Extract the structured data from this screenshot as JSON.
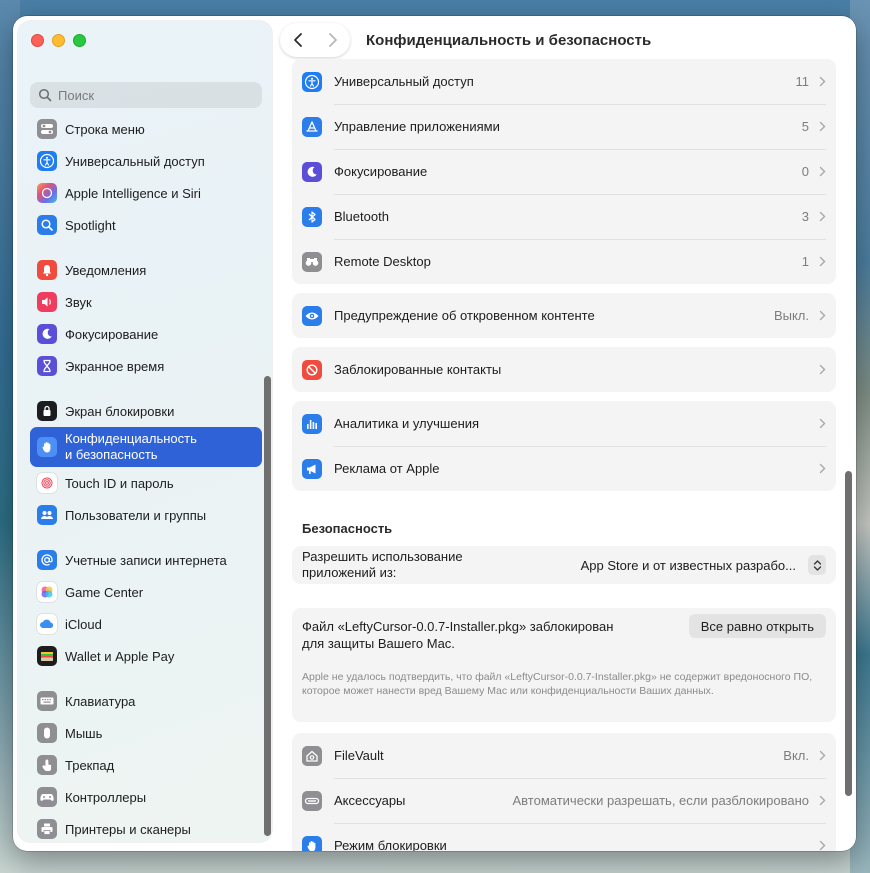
{
  "window": {
    "title": "Конфиденциальность и безопасность"
  },
  "search": {
    "placeholder": "Поиск"
  },
  "sidebar": {
    "items": [
      {
        "label": "Строка меню",
        "icon": "menubar-icon",
        "color": "#8e8e93"
      },
      {
        "label": "Универсальный доступ",
        "icon": "accessibility-icon",
        "color": "#1f7cf1"
      },
      {
        "label": "Apple Intelligence и Siri",
        "icon": "siri-icon",
        "color": "#e58a5a"
      },
      {
        "label": "Spotlight",
        "icon": "spotlight-icon",
        "color": "#2b7de9"
      },
      {
        "label": "Уведомления",
        "icon": "notifications-icon",
        "color": "#ef4b3f"
      },
      {
        "label": "Звук",
        "icon": "sound-icon",
        "color": "#ee3d5f"
      },
      {
        "label": "Фокусирование",
        "icon": "focus-icon",
        "color": "#5b4fd8"
      },
      {
        "label": "Экранное время",
        "icon": "screentime-icon",
        "color": "#5b4fd8"
      },
      {
        "label": "Экран блокировки",
        "icon": "lockscreen-icon",
        "color": "#1d1d1f"
      },
      {
        "label": "Конфиденциальность и безопасность",
        "label_line1": "Конфиденциальность",
        "label_line2": "и безопасность",
        "icon": "privacy-hand-icon",
        "color": "#2f7bf0"
      },
      {
        "label": "Touch ID и пароль",
        "icon": "touchid-icon",
        "color": "#ffffff"
      },
      {
        "label": "Пользователи и группы",
        "icon": "users-icon",
        "color": "#2b7de9"
      },
      {
        "label": "Учетные записи интернета",
        "icon": "internet-accounts-icon",
        "color": "#2b7de9"
      },
      {
        "label": "Game Center",
        "icon": "gamecenter-icon",
        "color": "#ffffff"
      },
      {
        "label": "iCloud",
        "icon": "icloud-icon",
        "color": "#ffffff"
      },
      {
        "label": "Wallet и Apple Pay",
        "icon": "wallet-icon",
        "color": "#1d1d1f"
      },
      {
        "label": "Клавиатура",
        "icon": "keyboard-icon",
        "color": "#8e8e93"
      },
      {
        "label": "Мышь",
        "icon": "mouse-icon",
        "color": "#8e8e93"
      },
      {
        "label": "Трекпад",
        "icon": "trackpad-icon",
        "color": "#8e8e93"
      },
      {
        "label": "Контроллеры",
        "icon": "controllers-icon",
        "color": "#8e8e93"
      },
      {
        "label": "Принтеры и сканеры",
        "icon": "printers-icon",
        "color": "#8e8e93"
      }
    ]
  },
  "main": {
    "group1": [
      {
        "label": "Универсальный доступ",
        "value": "11",
        "icon": "accessibility-icon",
        "color": "#1f7cf1"
      },
      {
        "label": "Управление приложениями",
        "value": "5",
        "icon": "app-management-icon",
        "color": "#2b7de9"
      },
      {
        "label": "Фокусирование",
        "value": "0",
        "icon": "focus-icon",
        "color": "#5b4fd8"
      },
      {
        "label": "Bluetooth",
        "value": "3",
        "icon": "bluetooth-icon",
        "color": "#2b7de9"
      },
      {
        "label": "Remote Desktop",
        "value": "1",
        "icon": "remote-desktop-icon",
        "color": "#8e8e93"
      }
    ],
    "sensitive": {
      "label": "Предупреждение об откровенном контенте",
      "value": "Выкл.",
      "icon": "sensitive-content-icon",
      "color": "#2b7de9"
    },
    "blocked_contacts": {
      "label": "Заблокированные контакты",
      "icon": "blocked-icon",
      "color": "#ef4b3f"
    },
    "group3": [
      {
        "label": "Аналитика и улучшения",
        "icon": "analytics-icon",
        "color": "#2b7de9"
      },
      {
        "label": "Реклама от Apple",
        "icon": "ads-icon",
        "color": "#2b7de9"
      }
    ],
    "security_title": "Безопасность",
    "allow": {
      "label": "Разрешить использование приложений из:",
      "label_line1": "Разрешить использование",
      "label_line2": "приложений из:",
      "value": "App Store и от известных разрабо..."
    },
    "blocked_file": {
      "text_line1": "Файл «LeftyCursor-0.0.7-Installer.pkg» заблокирован",
      "text_line2": "для защиты Вашего Mac.",
      "button": "Все равно открыть",
      "note": "Apple не удалось подтвердить, что файл «LeftyCursor-0.0.7-Installer.pkg» не содержит вредоносного ПО, которое может нанести вред Вашему Mac или конфиденциальности Ваших данных."
    },
    "group4": [
      {
        "label": "FileVault",
        "value": "Вкл.",
        "icon": "filevault-icon",
        "color": "#8e8e93"
      },
      {
        "label": "Аксессуары",
        "value": "Автоматически разрешать, если разблокировано",
        "icon": "accessories-icon",
        "color": "#8e8e93"
      },
      {
        "label": "Режим блокировки",
        "value": "",
        "icon": "lockdown-hand-icon",
        "color": "#2b7de9"
      }
    ]
  }
}
